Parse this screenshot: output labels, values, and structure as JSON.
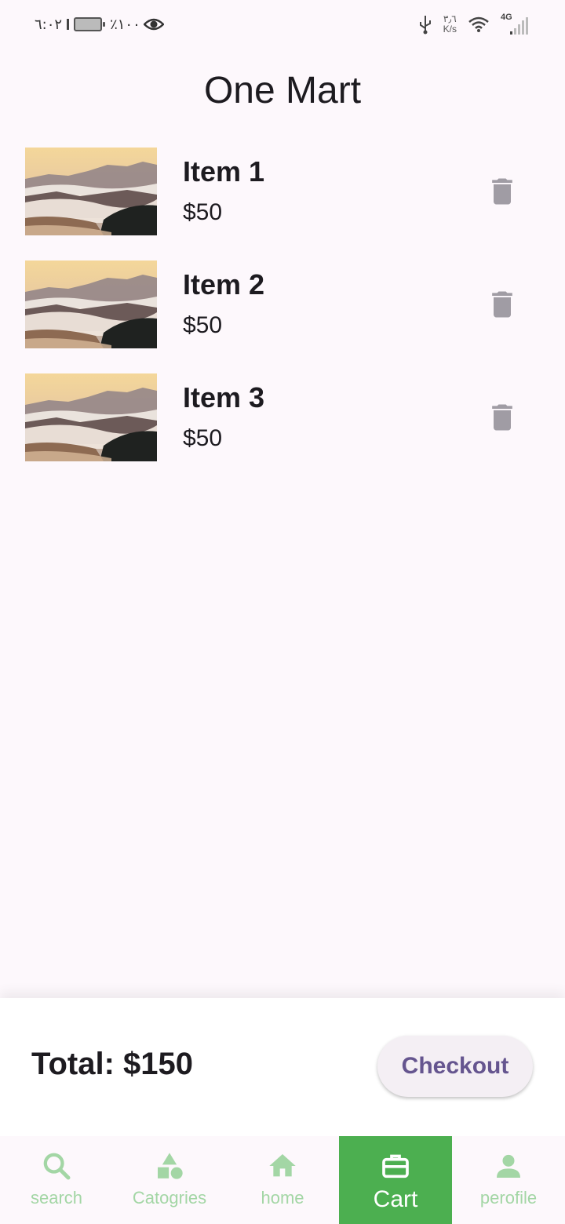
{
  "status_bar": {
    "time": "٦:٠٢",
    "battery_percent": "٪١٠٠",
    "net_speed_value": "٣٫٦",
    "net_speed_unit": "K/s",
    "network_type": "4G"
  },
  "app_title": "One Mart",
  "cart_items": [
    {
      "name": "Item 1",
      "price": "$50"
    },
    {
      "name": "Item 2",
      "price": "$50"
    },
    {
      "name": "Item 3",
      "price": "$50"
    }
  ],
  "total": {
    "label": "Total: $150"
  },
  "checkout_label": "Checkout",
  "nav": {
    "items": [
      {
        "label": "search",
        "icon": "search-icon"
      },
      {
        "label": "Catogries",
        "icon": "categories-icon"
      },
      {
        "label": "home",
        "icon": "home-icon"
      },
      {
        "label": "Cart",
        "icon": "cart-icon",
        "active": true
      },
      {
        "label": "perofile",
        "icon": "person-icon"
      }
    ]
  },
  "colors": {
    "background": "#fdf8fc",
    "nav_active": "#4caf50",
    "nav_inactive": "#a3d6a5",
    "checkout_text": "#65558f",
    "delete_icon": "#a09ca4"
  }
}
